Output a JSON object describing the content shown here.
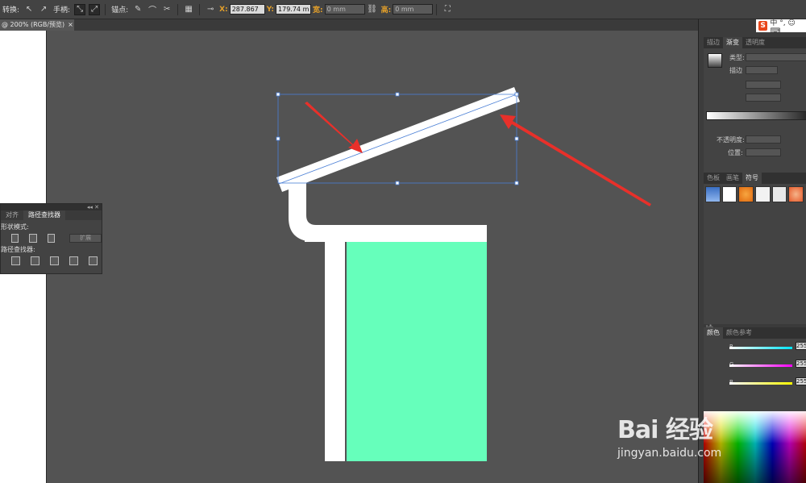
{
  "control_bar": {
    "convert_label": "转换:",
    "handles_label": "手柄:",
    "anchor_label": "锚点:",
    "x_label": "X:",
    "x_value": "287.867",
    "y_label": "Y:",
    "y_value": "179.74 m",
    "w_label": "宽:",
    "w_value": "0 mm",
    "h_label": "高:",
    "h_value": "0 mm"
  },
  "document": {
    "tab_label": "@ 200% (RGB/预览)",
    "close_glyph": "×"
  },
  "pathfinder_panel": {
    "collapse_glyph": "◂◂ ✕",
    "tabs": [
      {
        "label": "对齐",
        "active": false
      },
      {
        "label": "路径查找器",
        "active": true
      }
    ],
    "shape_modes_label": "形状模式:",
    "expand_label": "扩展",
    "pathfinders_label": "路径查找器:"
  },
  "ime": {
    "logo": "S",
    "text": "中 °, ☺ ⌨"
  },
  "gradient_panel": {
    "tabs": [
      {
        "label": "描边",
        "active": false
      },
      {
        "label": "渐变",
        "active": true
      },
      {
        "label": "透明度",
        "active": false
      }
    ],
    "type_label": "类型:",
    "stroke_label": "描边",
    "opacity_label": "不透明度:",
    "location_label": "位置:"
  },
  "symbols_panel": {
    "tabs": [
      {
        "label": "色板",
        "active": false
      },
      {
        "label": "画笔",
        "active": false
      },
      {
        "label": "符号",
        "active": true
      }
    ],
    "footer": "I⁂."
  },
  "color_panel": {
    "tabs": [
      {
        "label": "颜色",
        "active": true
      },
      {
        "label": "颜色参考",
        "active": false
      }
    ],
    "channels": [
      {
        "label": "R",
        "value": "255",
        "color": "#00e5ff"
      },
      {
        "label": "G",
        "value": "255",
        "color": "#ff00ff"
      },
      {
        "label": "B",
        "value": "255",
        "color": "#ffff00"
      }
    ]
  },
  "artwork": {
    "fill_color": "#66ffbb",
    "shape_color": "#ffffff",
    "arrow_color": "#e8302a",
    "selection_color": "#4a7fd6"
  },
  "watermark": {
    "brand": "Bai 经验",
    "url": "jingyan.baidu.com"
  }
}
